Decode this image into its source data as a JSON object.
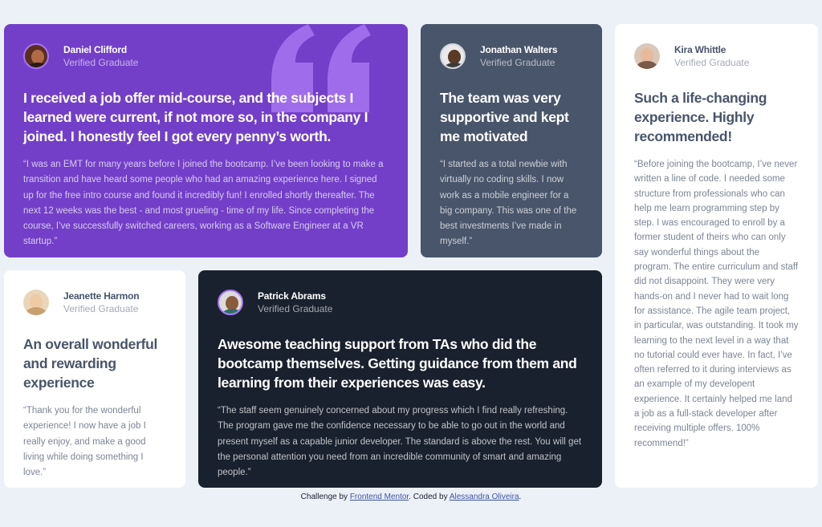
{
  "cards": [
    {
      "name": "Daniel Clifford",
      "role": "Verified Graduate",
      "headline": "I received a job offer mid-course, and the subjects I learned were current, if not more so, in the company I joined. I honestly feel I got every penny’s worth.",
      "body": "“I was an EMT for many years before I joined the bootcamp. I’ve been looking to make a transition and have heard some people who had an amazing experience here. I signed up for the free intro course and found it incredibly fun! I enrolled shortly thereafter. The next 12 weeks was the best - and most grueling - time of my life. Since completing the course, I’ve successfully switched careers, working as a Software Engineer at a VR startup.”"
    },
    {
      "name": "Jonathan Walters",
      "role": "Verified Graduate",
      "headline": "The team was very supportive and kept me motivated",
      "body": "“I started as a total newbie with virtually no coding skills. I now work as a mobile engineer for a big company. This was one of the best investments I’ve made in myself.”"
    },
    {
      "name": "Kira Whittle",
      "role": "Verified Graduate",
      "headline": "Such a life-changing experience. Highly recommended!",
      "body": "“Before joining the bootcamp, I’ve never written a line of code. I needed some structure from professionals who can help me learn programming step by step. I was encouraged to enroll by a former student of theirs who can only say wonderful things about the program. The entire curriculum and staff did not disappoint. They were very hands-on and I never had to wait long for assistance. The agile team project, in particular, was outstanding. It took my learning to the next level in a way that no tutorial could ever have. In fact, I’ve often referred to it during interviews as an example of my developent experience. It certainly helped me land a job as a full-stack developer after receiving multiple offers. 100% recommend!”"
    },
    {
      "name": "Jeanette Harmon",
      "role": "Verified Graduate",
      "headline": "An overall wonderful and rewarding experience",
      "body": "“Thank you for the wonderful experience! I now have a job I really enjoy, and make a good living while doing something I love.”"
    },
    {
      "name": "Patrick Abrams",
      "role": "Verified Graduate",
      "headline": "Awesome teaching support from TAs who did the bootcamp themselves. Getting guidance from them and learning from their experiences was easy.",
      "body": "“The staff seem genuinely concerned about my progress which I find really refreshing. The program gave me the confidence necessary to be able to go out in the world and present myself as a capable junior developer. The standard is above the rest. You will get the personal attention you need from an incredible community of smart and amazing people.”"
    }
  ],
  "footer": {
    "prefix": "Challenge by",
    "link1": "Frontend Mentor",
    "middle": ". Coded by",
    "link2": "Alessandra Oliveira",
    "suffix": "."
  },
  "colors": {
    "purple": "#733fc8",
    "slate": "#48556a",
    "dark": "#19212e",
    "background": "#ecf1f8",
    "quote_mark": "#a775f1"
  }
}
